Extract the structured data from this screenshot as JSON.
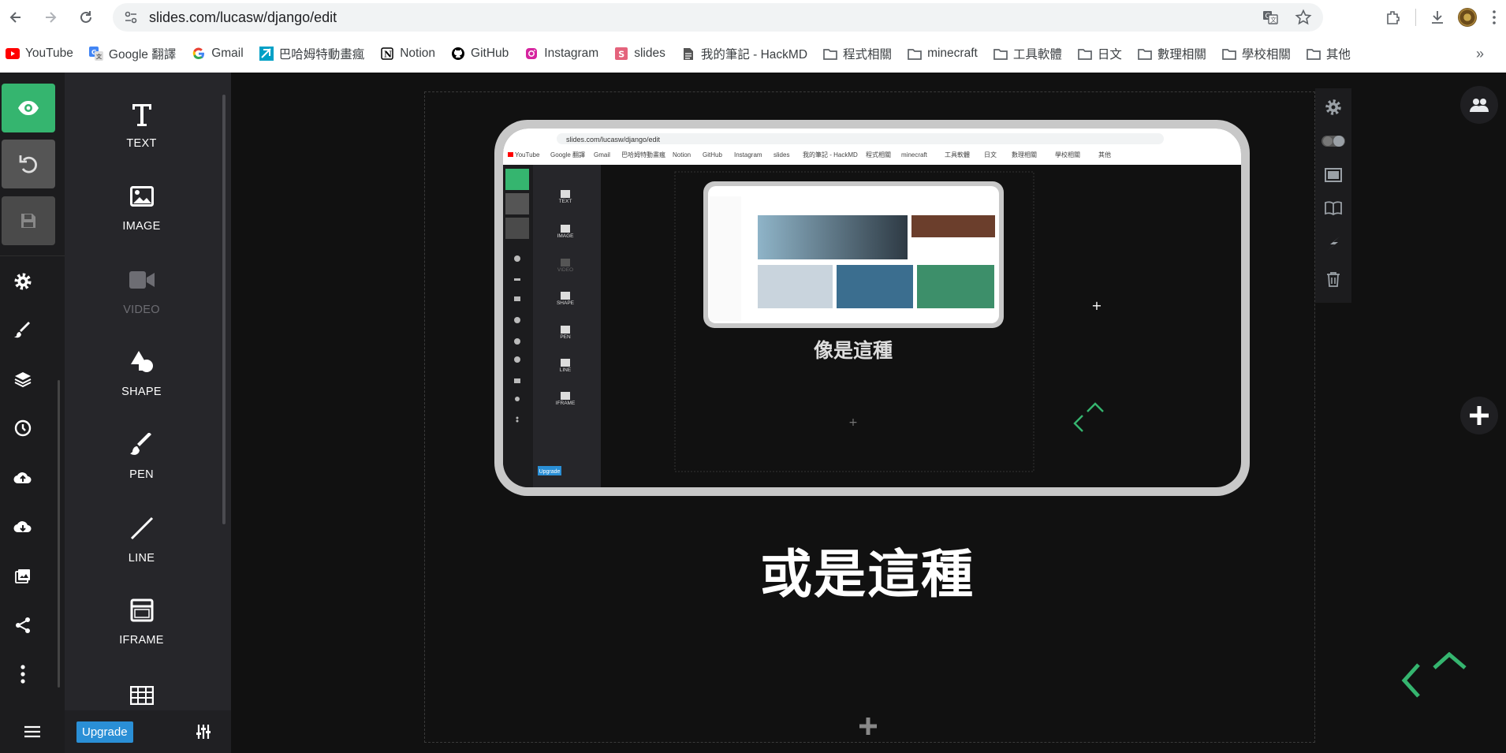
{
  "browser": {
    "url": "slides.com/lucasw/django/edit",
    "bookmarks": [
      {
        "label": "YouTube",
        "icon": "youtube-icon",
        "color": "#ff0000"
      },
      {
        "label": "Google 翻譯",
        "icon": "google-translate-icon",
        "color": "#4285f4"
      },
      {
        "label": "Gmail",
        "icon": "google-icon",
        "color": "#4285f4"
      },
      {
        "label": "巴哈姆特動畫瘋",
        "icon": "bahamut-icon",
        "color": "#00a0c6"
      },
      {
        "label": "Notion",
        "icon": "notion-icon",
        "color": "#000000"
      },
      {
        "label": "GitHub",
        "icon": "github-icon",
        "color": "#000000"
      },
      {
        "label": "Instagram",
        "icon": "instagram-icon",
        "color": "#d6249f"
      },
      {
        "label": "slides",
        "icon": "slides-icon",
        "color": "#e4637c"
      },
      {
        "label": "我的筆記 - HackMD",
        "icon": "document-icon",
        "color": "#444444"
      },
      {
        "label": "程式相關",
        "icon": "folder-icon",
        "color": "#444444"
      },
      {
        "label": "minecraft",
        "icon": "folder-icon",
        "color": "#444444"
      },
      {
        "label": "工具軟體",
        "icon": "folder-icon",
        "color": "#444444"
      },
      {
        "label": "日文",
        "icon": "folder-icon",
        "color": "#444444"
      },
      {
        "label": "數理相關",
        "icon": "folder-icon",
        "color": "#444444"
      },
      {
        "label": "學校相關",
        "icon": "folder-icon",
        "color": "#444444"
      },
      {
        "label": "其他",
        "icon": "folder-icon",
        "color": "#444444"
      }
    ]
  },
  "editor": {
    "tools": [
      {
        "label": "TEXT",
        "icon": "text-icon",
        "disabled": false
      },
      {
        "label": "IMAGE",
        "icon": "image-icon",
        "disabled": false
      },
      {
        "label": "VIDEO",
        "icon": "video-icon",
        "disabled": true
      },
      {
        "label": "SHAPE",
        "icon": "shape-icon",
        "disabled": false
      },
      {
        "label": "PEN",
        "icon": "pen-icon",
        "disabled": false
      },
      {
        "label": "LINE",
        "icon": "line-icon",
        "disabled": false
      },
      {
        "label": "IFRAME",
        "icon": "iframe-icon",
        "disabled": false
      },
      {
        "label": "",
        "icon": "table-icon",
        "disabled": false
      }
    ],
    "upgrade_label": "Upgrade",
    "accent_color": "#35b56f"
  },
  "slide": {
    "caption": "或是這種",
    "nested_caption": "像是這種",
    "nested_url": "slides.com/lucasw/django/edit",
    "nested_upgrade": "Upgrade",
    "nested_tools": [
      "TEXT",
      "IMAGE",
      "VIDEO",
      "SHAPE",
      "PEN",
      "LINE",
      "IFRAME"
    ]
  }
}
